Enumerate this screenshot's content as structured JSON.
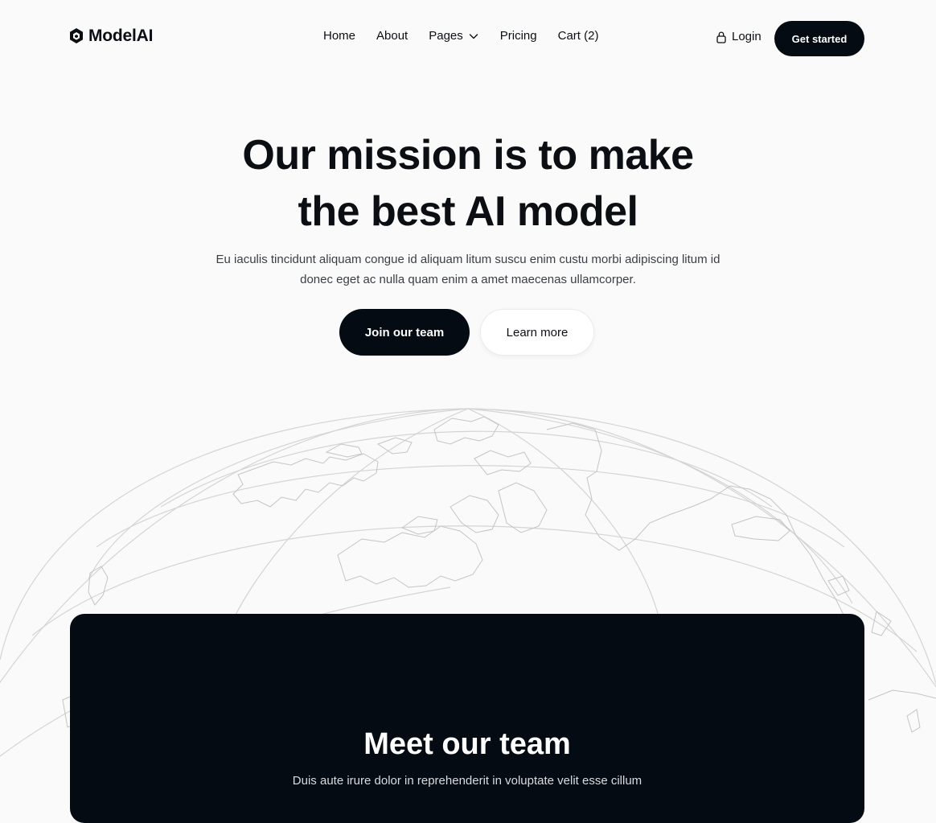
{
  "brand": {
    "name": "ModelAI",
    "icon": "hexagon-logo-icon"
  },
  "nav": {
    "items": [
      {
        "label": "Home"
      },
      {
        "label": "About"
      },
      {
        "label": "Pages",
        "icon": "chevron-down-icon"
      },
      {
        "label": "Pricing"
      },
      {
        "label": "Cart (2)"
      }
    ],
    "login_label": "Login",
    "login_icon": "lock-icon",
    "cta_label": "Get started"
  },
  "hero": {
    "title_line1": "Our mission is to make",
    "title_line2": "the best AI model",
    "subtitle": "Eu iaculis tincidunt aliquam congue id aliquam litum suscu enim custu morbi adipiscing litum id donec eget ac nulla quam enim a amet maecenas ullamcorper.",
    "primary_button": "Join our team",
    "secondary_button": "Learn more"
  },
  "team": {
    "title": "Meet our team",
    "subtitle": "Duis aute irure dolor in reprehenderit in voluptate velit esse cillum"
  },
  "colors": {
    "background": "#fafafa",
    "dark": "#050b12",
    "text": "#0b0f14",
    "muted": "#3a3f45",
    "globe_line": "#d0d0d0"
  }
}
